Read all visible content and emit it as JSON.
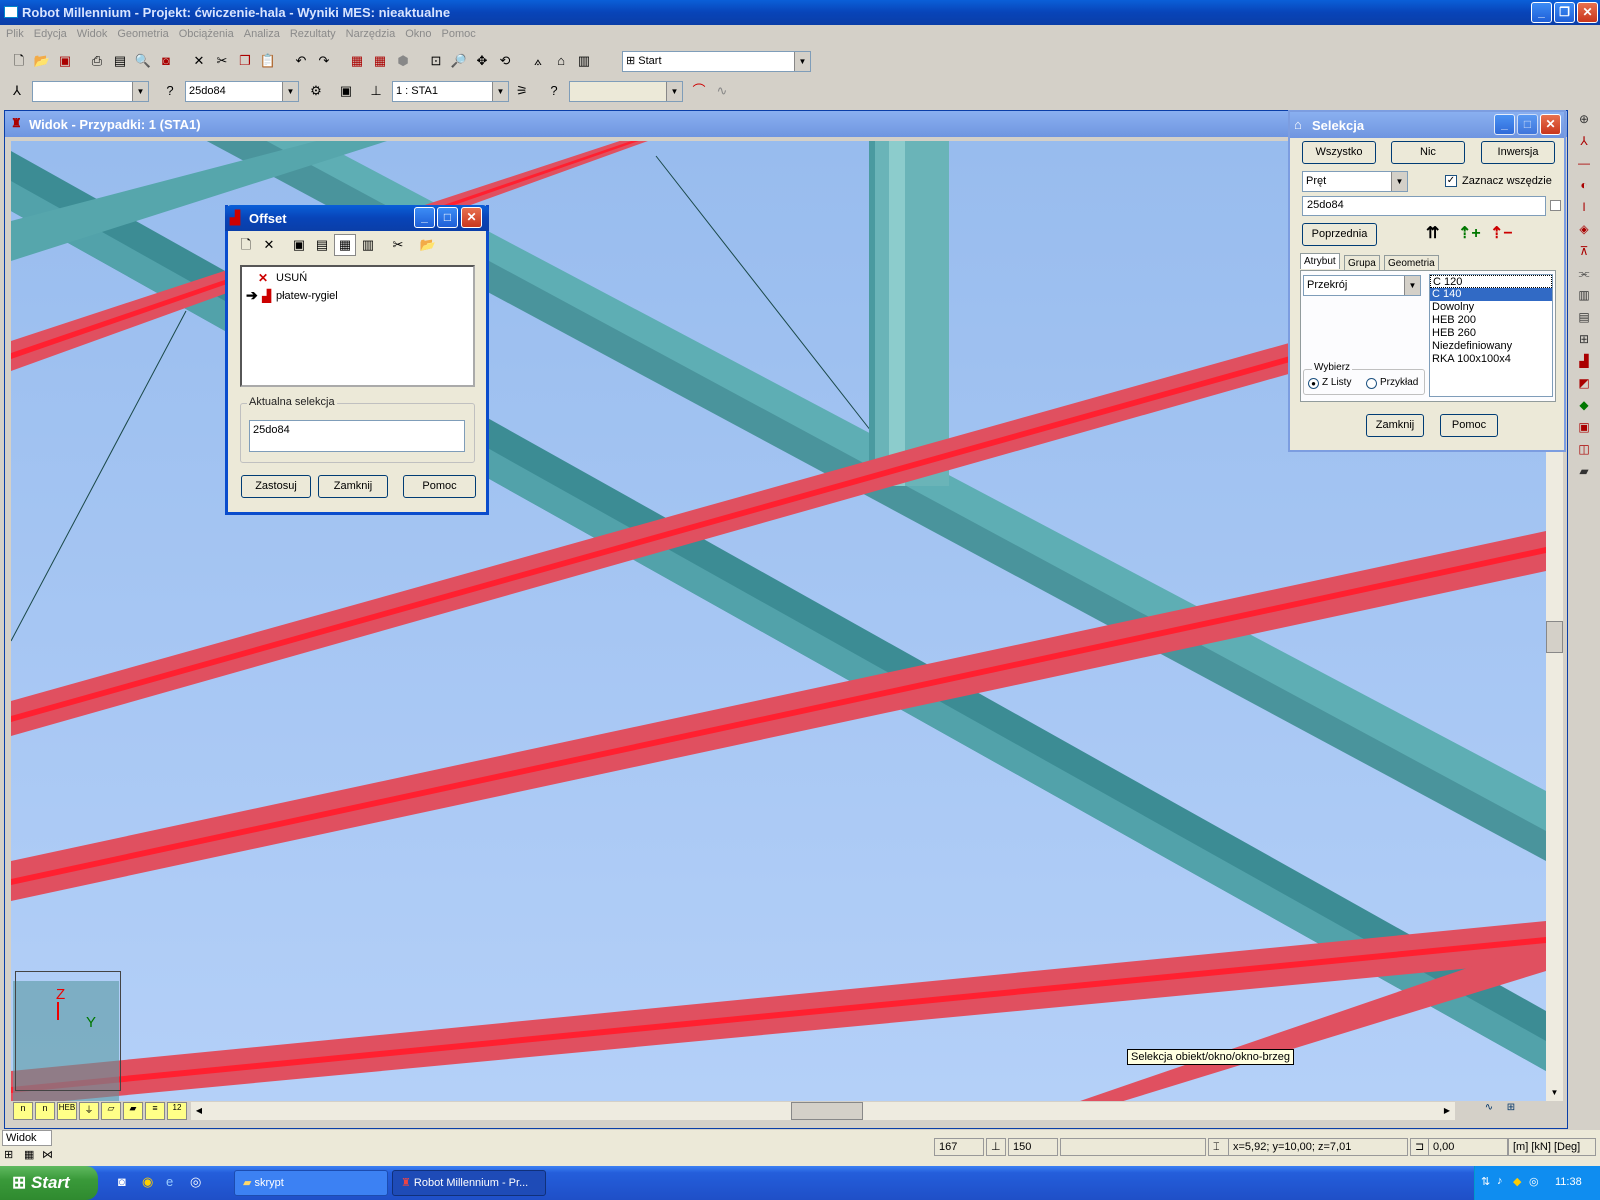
{
  "app": {
    "title": "Robot Millennium - Projekt: ćwiczenie-hala - Wyniki MES: nieaktualne"
  },
  "menu": [
    "Plik",
    "Edycja",
    "Widok",
    "Geometria",
    "Obciążenia",
    "Analiza",
    "Rezultaty",
    "Narzędzia",
    "Okno",
    "Pomoc"
  ],
  "toolbar": {
    "start_combo": "Start",
    "selection_combo": "25do84",
    "case_combo": "1 : STA1"
  },
  "view": {
    "title": "Widok - Przypadki: 1 (STA1)",
    "tooltip": "Selekcja obiekt/okno/okno-brzeg",
    "axis_z": "Z",
    "axis_y": "Y"
  },
  "offset": {
    "title": "Offset",
    "items": [
      {
        "label": "USUŃ",
        "icon": "delete-x-icon"
      },
      {
        "label": "płatew-rygiel",
        "icon": "offset-icon",
        "current": true
      }
    ],
    "group_label": "Aktualna selekcja",
    "selection_value": "25do84",
    "btn_apply": "Zastosuj",
    "btn_close": "Zamknij",
    "btn_help": "Pomoc"
  },
  "selekcja": {
    "title": "Selekcja",
    "btn_all": "Wszystko",
    "btn_none": "Nic",
    "btn_invert": "Inwersja",
    "type_combo": "Pręt",
    "check_label": "Zaznacz wszędzie",
    "check_checked": true,
    "selection_value": "25do84",
    "btn_prev": "Poprzednia",
    "tabs": [
      "Atrybut",
      "Grupa",
      "Geometria"
    ],
    "attr_combo": "Przekrój",
    "list": [
      "C 120",
      "C 140",
      "Dowolny",
      "HEB 200",
      "HEB 260",
      "Niezdefiniowany",
      "RKA 100x100x4"
    ],
    "list_selected": "C 140",
    "wybierz_label": "Wybierz",
    "radio_list": "Z Listy",
    "radio_example": "Przykład",
    "btn_close": "Zamknij",
    "btn_help": "Pomoc"
  },
  "statusbar": {
    "widok_label": "Widok",
    "nodes": "167",
    "bars": "150",
    "coords": "x=5,92; y=10,00; z=7,01",
    "angle": "0,00",
    "units": "[m] [kN] [Deg]"
  },
  "taskbar": {
    "start": "Start",
    "tasks": [
      "skrypt",
      "Robot Millennium - Pr..."
    ],
    "clock": "11:38"
  }
}
